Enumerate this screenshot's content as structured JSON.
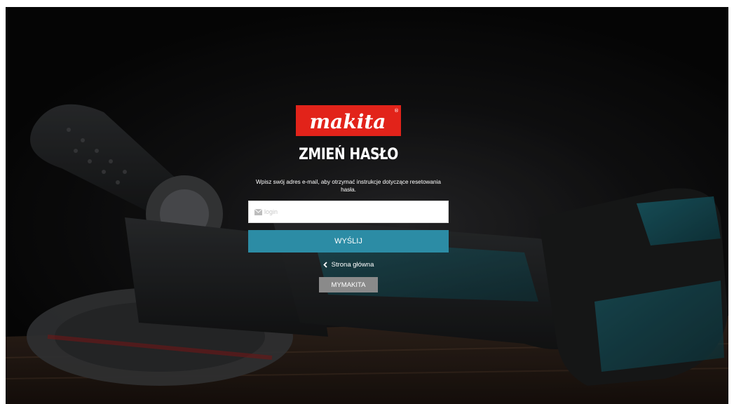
{
  "brand": {
    "logo_text": "makita",
    "registered_mark": "®",
    "logo_color": "#e2231a"
  },
  "page": {
    "title": "ZMIEŃ HASŁO",
    "instructions": "Wpisz swój adres e-mail, aby otrzymać instrukcje dotyczące resetowania hasła."
  },
  "form": {
    "login_icon": "envelope-icon",
    "login_placeholder": "login",
    "login_value": "",
    "submit_label": "WYŚLIJ",
    "submit_color": "#2c8ca5"
  },
  "links": {
    "home_icon": "chevron-left-icon",
    "home_label": "Strona główna",
    "mymakita_label": "MYMAKITA"
  }
}
